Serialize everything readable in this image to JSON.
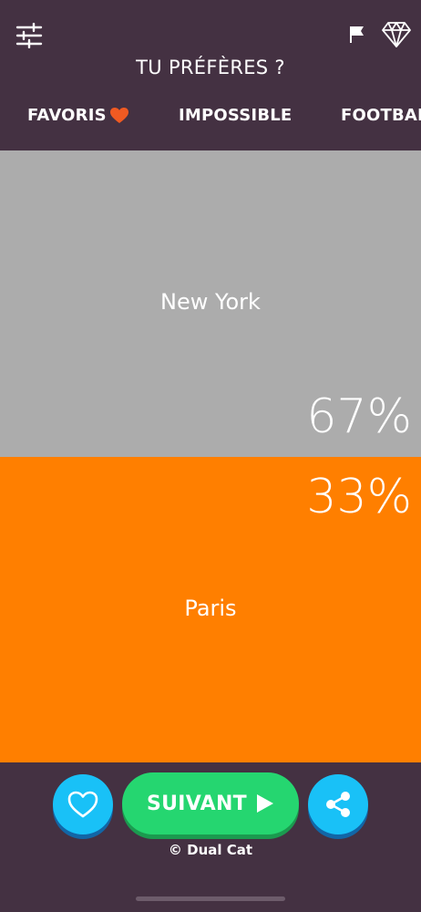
{
  "header": {
    "title": "TU PRÉFÈRES ?",
    "icons": {
      "settings": "sliders-icon",
      "report": "flag-icon",
      "premium": "diamond-icon"
    }
  },
  "tabs": [
    {
      "label": "FAVORIS",
      "icon": "heart-icon"
    },
    {
      "label": "IMPOSSIBLE"
    },
    {
      "label": "FOOTBALL"
    }
  ],
  "options": {
    "a": {
      "label": "New York",
      "percent": "67%",
      "color": "#acacac"
    },
    "b": {
      "label": "Paris",
      "percent": "33%",
      "color": "#ff7f00"
    }
  },
  "footer": {
    "next_label": "SUIVANT",
    "copyright": "© Dual Cat",
    "icons": {
      "like": "heart-outline-icon",
      "share": "share-icon",
      "next": "play-icon"
    }
  },
  "colors": {
    "background": "#443142",
    "accent_blue": "#19c1f7",
    "accent_green": "#25d670",
    "favorite_heart": "#f05a22"
  }
}
